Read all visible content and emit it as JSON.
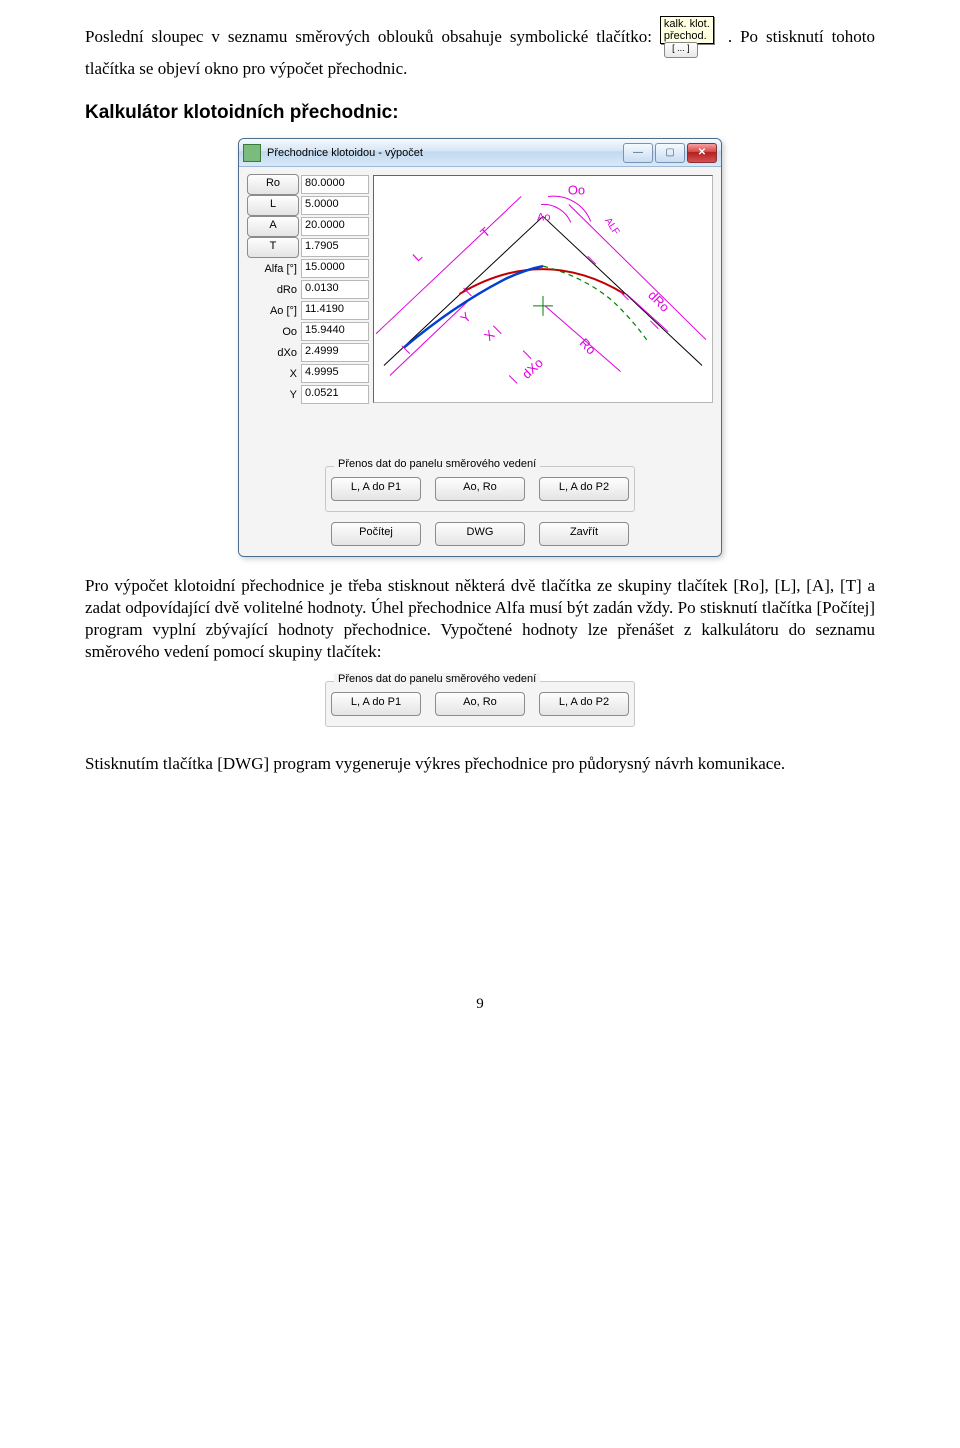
{
  "tooltip": {
    "line1": "kalk. klot.",
    "line2": "přechod.",
    "btn": "[ ... ]"
  },
  "p1a": "Poslední sloupec v seznamu směrových oblouků obsahuje symbolické tlačítko: ",
  "p1b": ". Po stisknutí tohoto tlačítka se objeví okno pro výpočet přechodnic.",
  "h1": "Kalkulátor klotoidních přechodnic:",
  "dialog": {
    "title": "Přechodnice klotoidou - výpočet",
    "params": [
      {
        "type": "btn",
        "label": "Ro",
        "value": "80.0000"
      },
      {
        "type": "btn",
        "label": "L",
        "value": "5.0000"
      },
      {
        "type": "btn",
        "label": "A",
        "value": "20.0000"
      },
      {
        "type": "btn",
        "label": "T",
        "value": "1.7905"
      },
      {
        "type": "lbl",
        "label": "Alfa [°]",
        "value": "15.0000"
      },
      {
        "type": "lbl",
        "label": "dRo",
        "value": "0.0130"
      },
      {
        "type": "lbl",
        "label": "Ao [°]",
        "value": "11.4190"
      },
      {
        "type": "lbl",
        "label": "Oo",
        "value": "15.9440"
      },
      {
        "type": "lbl",
        "label": "dXo",
        "value": "2.4999"
      },
      {
        "type": "lbl",
        "label": "X",
        "value": "4.9995"
      },
      {
        "type": "lbl",
        "label": "Y",
        "value": "0.0521"
      }
    ],
    "group_title": "Přenos dat do panelu směrového vedení",
    "transfer": [
      "L, A do P1",
      "Ao, Ro",
      "L, A do P2"
    ],
    "footer": [
      "Počítej",
      "DWG",
      "Zavřít"
    ]
  },
  "p2": "Pro výpočet klotoidní přechodnice je třeba stisknout některá dvě tlačítka ze skupiny tlačítek [Ro], [L], [A], [T] a zadat odpovídající dvě volitelné hodnoty. Úhel přechodnice Alfa musí být zadán vždy. Po stisknutí tlačítka [Počítej] program vyplní zbývající hodnoty přechodnice. Vypočtené hodnoty lze přenášet z kalkulátoru do seznamu směrového vedení pomocí skupiny tlačítek:",
  "p3": "Stisknutím tlačítka [DWG] program vygeneruje výkres přechodnice pro půdorysný návrh komunikace.",
  "page": "9"
}
